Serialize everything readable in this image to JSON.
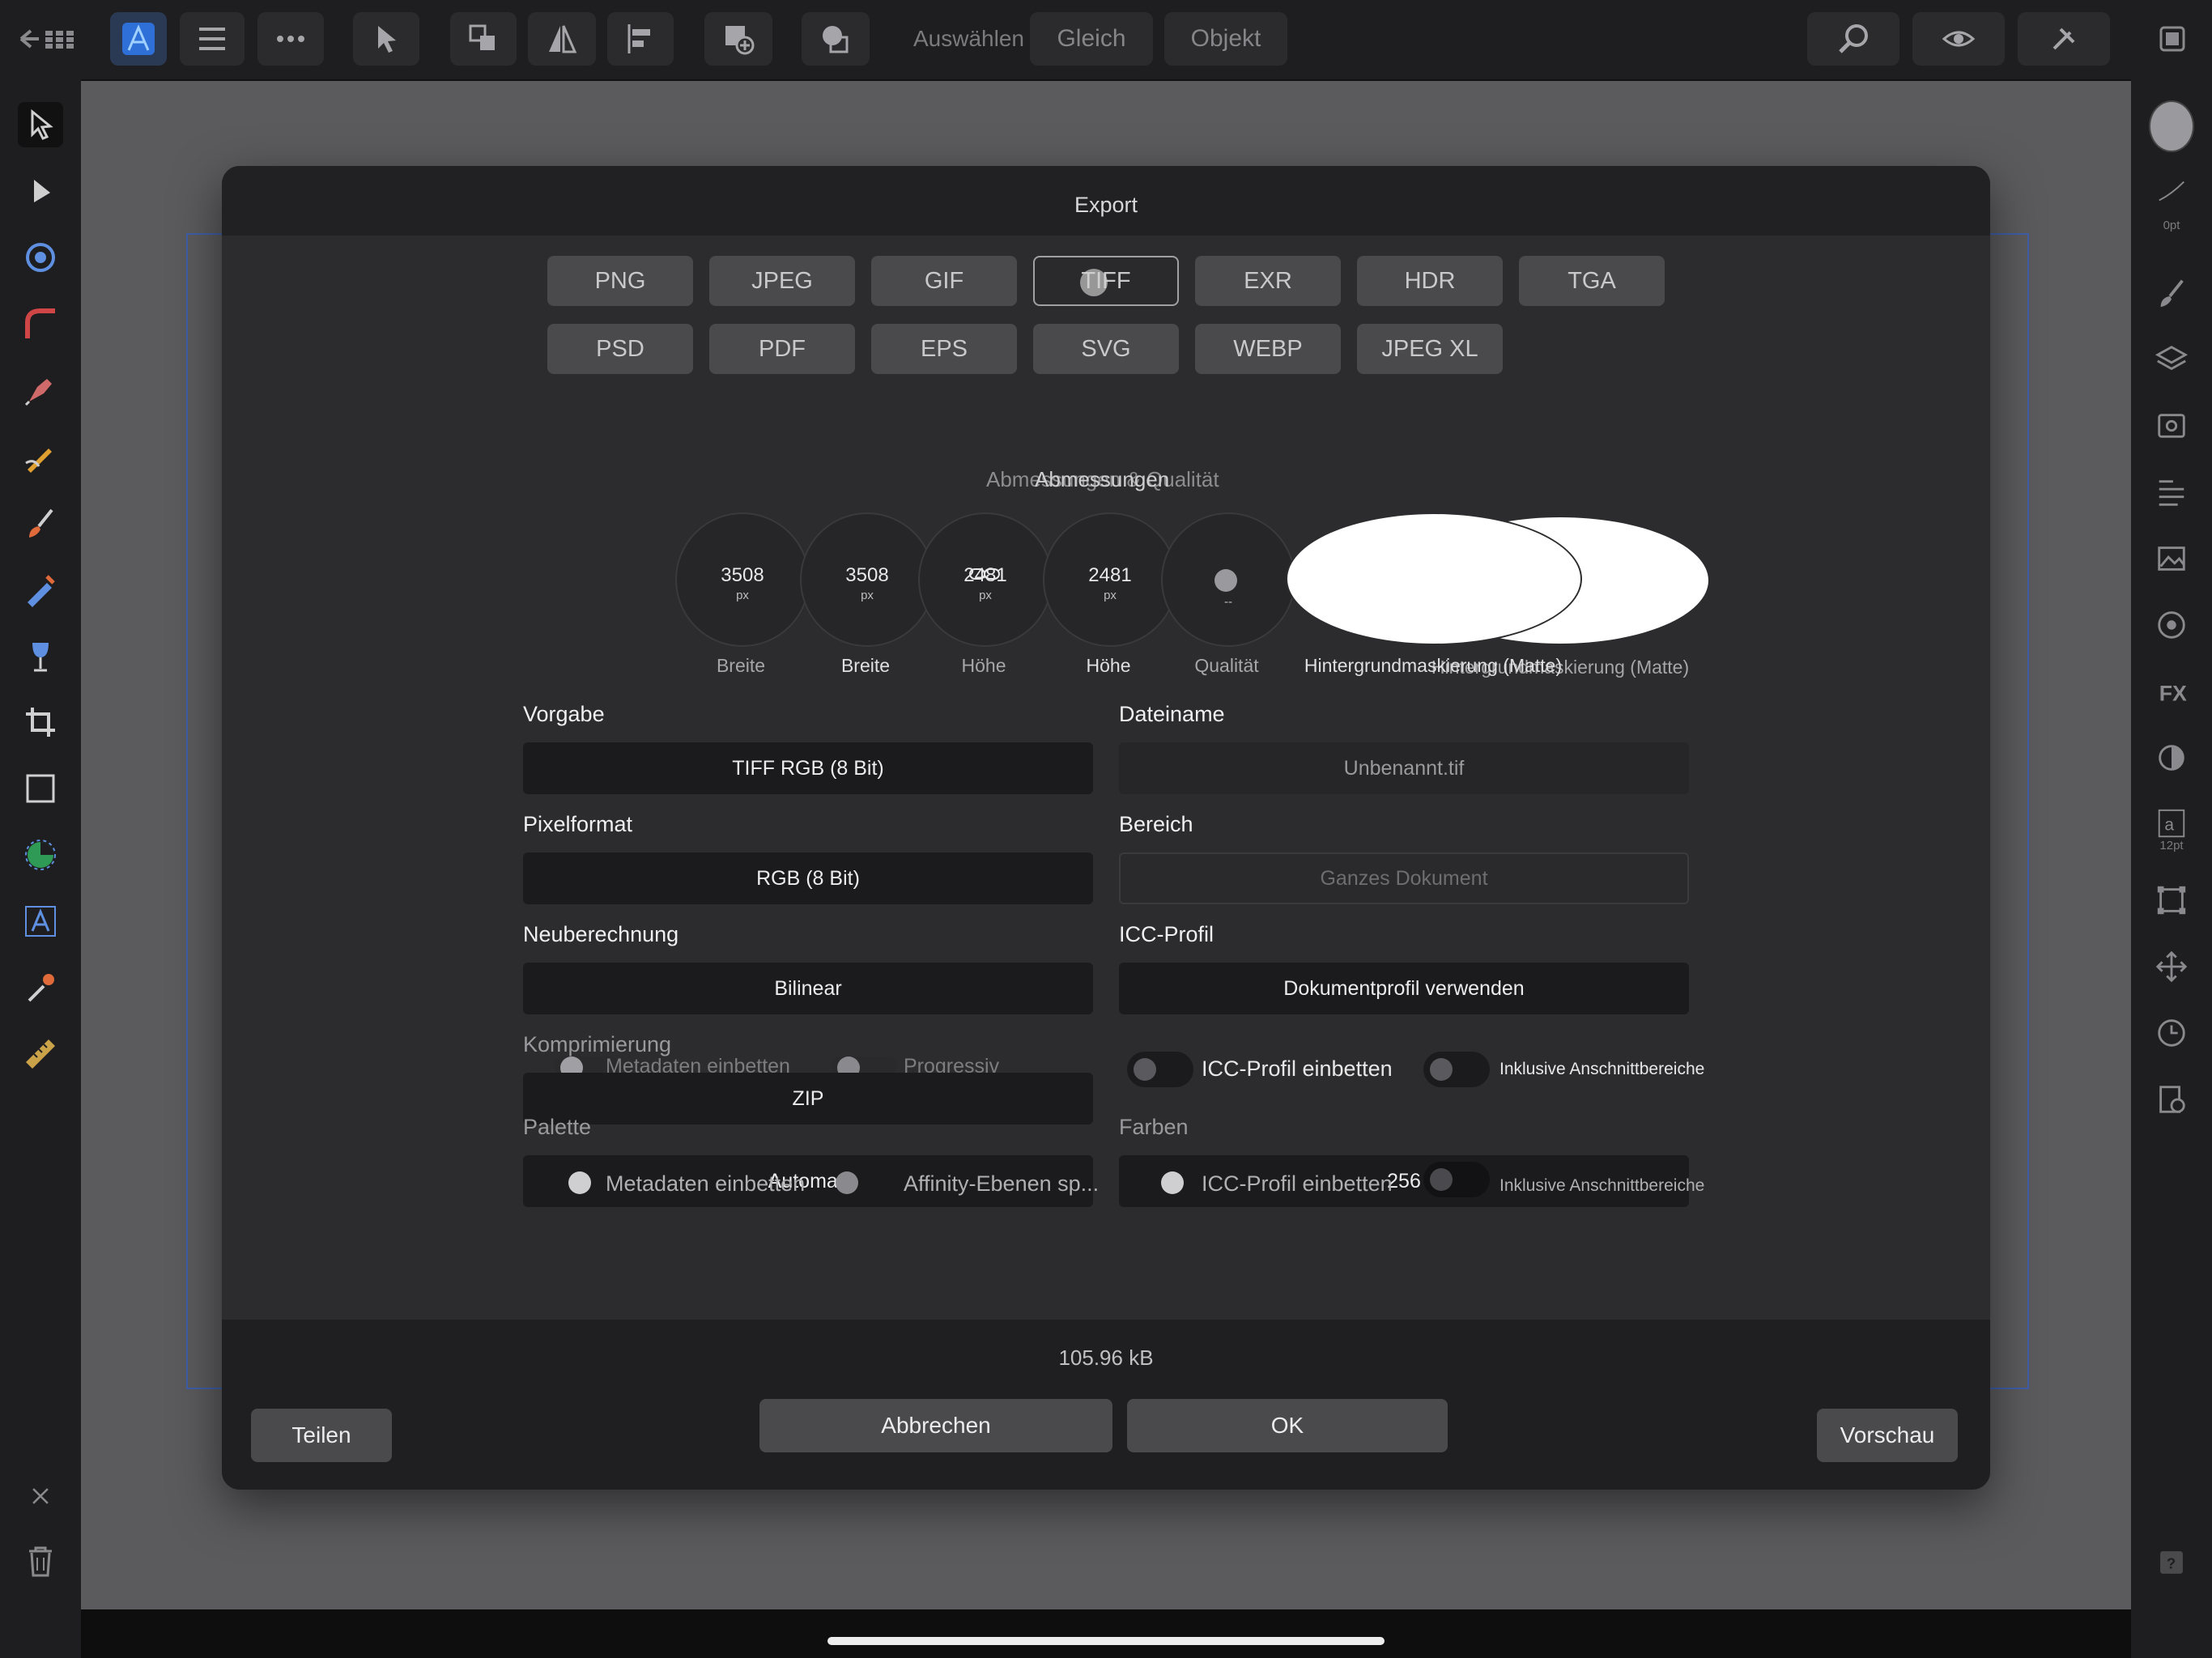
{
  "toolbar": {
    "auswaehlen": "Auswählen",
    "gleich": "Gleich",
    "objekt": "Objekt"
  },
  "right_panel": {
    "stroke_width": "0pt",
    "text_size": "12pt"
  },
  "dialog": {
    "title": "Export",
    "formats_row1": [
      "PNG",
      "JPEG",
      "GIF",
      "TIFF",
      "EXR",
      "HDR",
      "TGA"
    ],
    "formats_row2": [
      "PSD",
      "PDF",
      "EPS",
      "SVG",
      "WEBP",
      "JPEG XL"
    ],
    "selected_format": "TIFF",
    "section_title_a": "Abmessungen & Qualität",
    "section_title_b": "Abmessungen",
    "dials": [
      {
        "value": "3508",
        "unit": "px",
        "label": "Breite"
      },
      {
        "value": "3508",
        "unit": "px",
        "label": "Breite"
      },
      {
        "value": "2481",
        "unit": "px",
        "label": "Höhe"
      },
      {
        "value": "2481",
        "unit": "px",
        "label": "Höhe"
      },
      {
        "value": "",
        "unit": "--",
        "label": "Qualität"
      }
    ],
    "matte_label_a": "Hintergrundmaskierung (Matte)",
    "matte_label_b": "Hintergrundmaskierung (Matte)",
    "vorgabe_label": "Vorgabe",
    "vorgabe_value": "TIFF RGB (8 Bit)",
    "dateiname_label": "Dateiname",
    "dateiname_value": "Unbenannt.tif",
    "pixelformat_label": "Pixelformat",
    "pixelformat_value": "RGB (8 Bit)",
    "bereich_label": "Bereich",
    "bereich_value": "Ganzes Dokument",
    "neuberechnung_label": "Neuberechnung",
    "neuberechnung_value": "Bilinear",
    "icc_label": "ICC-Profil",
    "icc_value": "Dokumentprofil verwenden",
    "komprimierung_label": "Komprimierung",
    "komprimierung_value": "ZIP",
    "palette_label": "Palette",
    "palette_value": "Automati",
    "farben_label": "Farben",
    "farben_value": "256",
    "toggle_metadaten": "Metadaten einbetten",
    "toggle_progressiv": "Progressiv",
    "toggle_icc_embed": "ICC-Profil einbetten",
    "toggle_anschnitt": "Inklusive Anschnittbereiche",
    "toggle_metadaten_2": "Metadaten einbetten",
    "toggle_affinity": "Affinity-Ebenen sp...",
    "toggle_icc_embed_2": "ICC-Profil einbetten",
    "toggle_anschnitt_2": "Inklusive Anschnittbereiche",
    "file_size": "105.96 kB",
    "btn_teilen": "Teilen",
    "btn_abbrechen": "Abbrechen",
    "btn_ok": "OK",
    "btn_vorschau": "Vorschau"
  }
}
